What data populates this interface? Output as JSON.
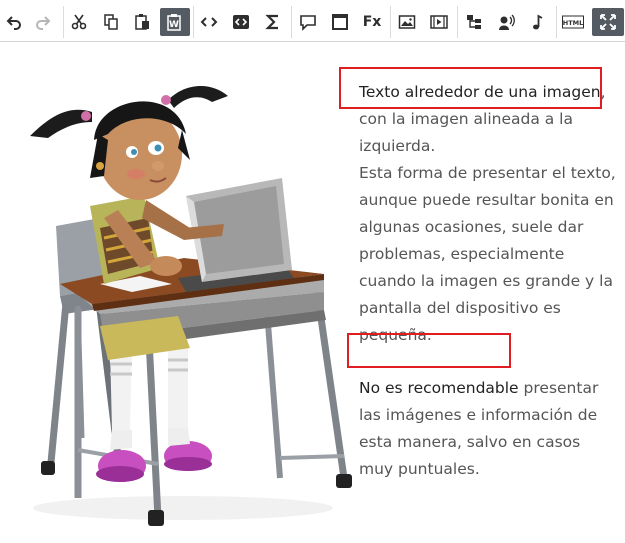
{
  "toolbar": {
    "buttons": [
      {
        "name": "undo-button",
        "icon": "undo-icon",
        "enabled": true
      },
      {
        "name": "redo-button",
        "icon": "redo-icon",
        "enabled": false
      },
      {
        "name": "cut-button",
        "icon": "scissors-icon"
      },
      {
        "name": "copy-button",
        "icon": "copy-icon"
      },
      {
        "name": "paste-button",
        "icon": "clipboard-icon"
      },
      {
        "name": "paste-from-word-button",
        "icon": "paste-word-icon",
        "active": true
      },
      {
        "name": "source-code-button",
        "icon": "code-icon"
      },
      {
        "name": "code-snippet-button",
        "icon": "code-box-icon"
      },
      {
        "name": "math-symbol-button",
        "icon": "sigma-icon"
      },
      {
        "name": "comment-button",
        "icon": "speech-bubble-icon"
      },
      {
        "name": "iframe-button",
        "icon": "window-icon"
      },
      {
        "name": "formula-button",
        "icon": "fx-icon"
      },
      {
        "name": "image-button",
        "icon": "image-icon"
      },
      {
        "name": "video-button",
        "icon": "film-icon"
      },
      {
        "name": "diagram-button",
        "icon": "tree-icon"
      },
      {
        "name": "speech-button",
        "icon": "speaker-icon"
      },
      {
        "name": "music-button",
        "icon": "music-note-icon"
      },
      {
        "name": "html-button",
        "icon": "html-icon"
      },
      {
        "name": "fullscreen-button",
        "icon": "fullscreen-icon",
        "active": true
      }
    ],
    "fx_label": "Fx",
    "html_label": "HTML"
  },
  "figure": {
    "subject": "girl-at-laptop-illustration"
  },
  "content": {
    "p1_highlight": "Texto alrededor de una imagen",
    "p1_rest": ", con la imagen alineada a la izquierda.",
    "p2": "Esta forma de presentar el texto, aunque puede resultar bonita en algunas ocasiones, suele dar problemas, especialmente cuando la imagen es grande y la pantalla del dispositivo es pequeña.",
    "p3_highlight": "No es recomendable",
    "p3_rest": " presentar las imágenes e información de esta manera, salvo en casos muy puntuales."
  },
  "colors": {
    "active_button": "#555b63",
    "annotation_border": "#e01e22",
    "body_text": "#555555",
    "highlight_text": "#222222"
  }
}
